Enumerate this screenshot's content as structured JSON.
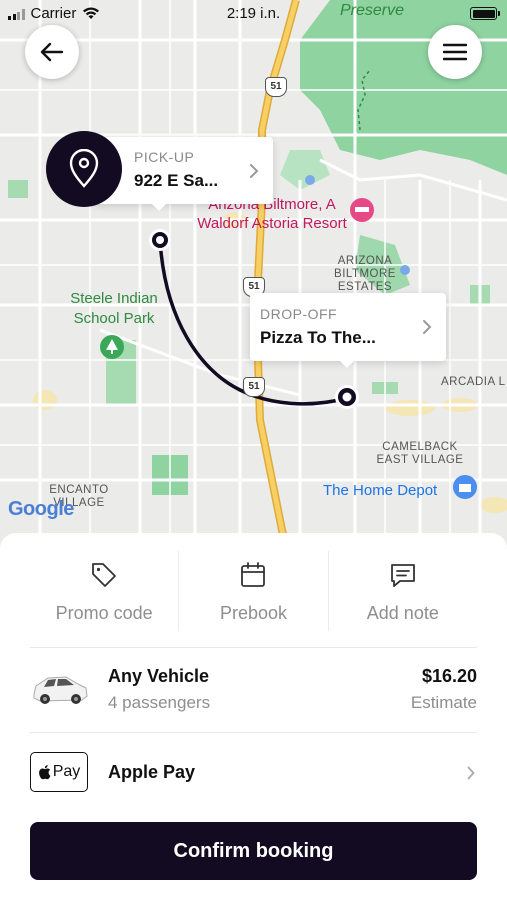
{
  "status_bar": {
    "carrier": "Carrier",
    "time": "2:19 i.n."
  },
  "map": {
    "labels": {
      "preserve": "Preserve",
      "biltmore_resort_line1": "Arizona Biltmore, A",
      "biltmore_resort_line2": "Waldorf Astoria Resort",
      "arizona_biltmore_estates_1": "ARIZONA",
      "arizona_biltmore_estates_2": "BILTMORE",
      "arizona_biltmore_estates_3": "ESTATES",
      "steele_park_1": "Steele Indian",
      "steele_park_2": "School Park",
      "arcadia": "ARCADIA L",
      "camelback_1": "CAMELBACK",
      "camelback_2": "EAST VILLAGE",
      "home_depot": "The Home Depot",
      "encanto_1": "ENCANTO",
      "encanto_2": "VILLAGE",
      "google": "Google"
    },
    "route_shields": [
      "51",
      "51",
      "51"
    ]
  },
  "pickup": {
    "caption": "PICK-UP",
    "value": "922 E Sa..."
  },
  "dropoff": {
    "caption": "DROP-OFF",
    "value": "Pizza To The..."
  },
  "actions": [
    {
      "label": "Promo code",
      "icon": "tag-icon"
    },
    {
      "label": "Prebook",
      "icon": "calendar-icon"
    },
    {
      "label": "Add note",
      "icon": "message-icon"
    }
  ],
  "vehicle": {
    "title": "Any Vehicle",
    "passengers": "4 passengers",
    "price": "$16.20",
    "price_note": "Estimate",
    "icon": "car-icon"
  },
  "payment": {
    "badge": "Pay",
    "label": "Apple Pay"
  },
  "confirm_label": "Confirm booking",
  "colors": {
    "primary": "#130b22",
    "map_green": "#86d09b",
    "highway": "#f5c34a"
  }
}
